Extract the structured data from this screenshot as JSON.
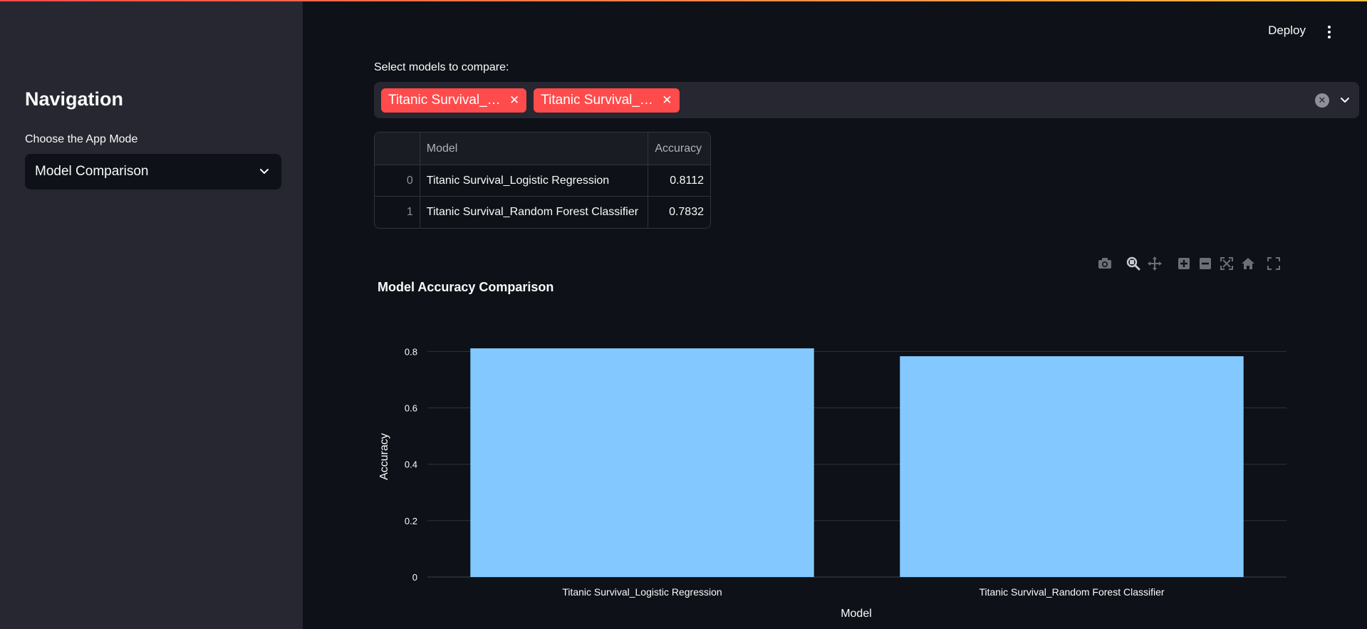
{
  "sidebar": {
    "title": "Navigation",
    "mode_label": "Choose the App Mode",
    "mode_value": "Model Comparison"
  },
  "header": {
    "deploy_label": "Deploy"
  },
  "model_select": {
    "label": "Select models to compare:",
    "tags": [
      "Titanic Survival_Logistic Regression",
      "Titanic Survival_Random Forest Classifier"
    ],
    "tag_display": [
      "Titanic Survival_…",
      "Titanic Survival_…"
    ],
    "tag_color": "#ff4b4b"
  },
  "table": {
    "columns": [
      "",
      "Model",
      "Accuracy"
    ],
    "rows": [
      {
        "index": "0",
        "model": "Titanic Survival_Logistic Regression",
        "accuracy": "0.8112"
      },
      {
        "index": "1",
        "model": "Titanic Survival_Random Forest Classifier",
        "accuracy": "0.7832"
      }
    ]
  },
  "modebar": {
    "icons": [
      "camera-icon",
      "zoom-icon",
      "pan-icon",
      "zoom-in-icon",
      "zoom-out-icon",
      "autoscale-icon",
      "reset-axes-icon",
      "fullscreen-icon"
    ]
  },
  "chart_data": {
    "type": "bar",
    "title": "Model Accuracy Comparison",
    "xlabel": "Model",
    "ylabel": "Accuracy",
    "categories": [
      "Titanic Survival_Logistic Regression",
      "Titanic Survival_Random Forest Classifier"
    ],
    "values": [
      0.8112,
      0.7832
    ],
    "ylim": [
      0,
      0.8112
    ],
    "yticks": [
      0,
      0.2,
      0.4,
      0.6,
      0.8
    ],
    "ytick_labels": [
      "0",
      "0.2",
      "0.4",
      "0.6",
      "0.8"
    ],
    "bar_color": "#83c9ff",
    "grid": true
  },
  "colors": {
    "background": "#0e1117",
    "sidebar": "#262730",
    "accent": "#ff4b4b"
  }
}
